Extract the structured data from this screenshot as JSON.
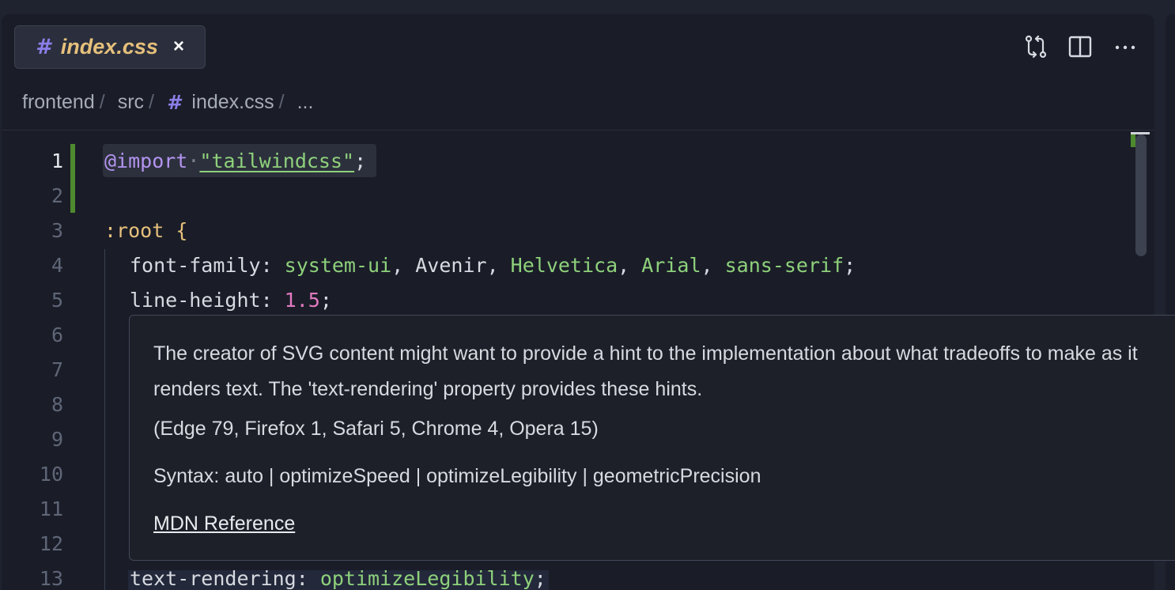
{
  "tab": {
    "icon": "hash-icon",
    "label": "index.css",
    "close": "×"
  },
  "toolbar": {
    "compare_icon": "git-compare-icon",
    "split_icon": "split-editor-icon",
    "more_icon": "ellipsis-icon",
    "more_label": "···"
  },
  "breadcrumb": {
    "items": [
      "frontend",
      "src",
      "index.css",
      "..."
    ],
    "separator": "/"
  },
  "editor": {
    "line_numbers": [
      "1",
      "2",
      "3",
      "4",
      "5",
      "6",
      "7",
      "8",
      "9",
      "10",
      "11",
      "12",
      "13"
    ],
    "active_line": "1",
    "line1": {
      "at": "@import",
      "dot": "·",
      "str": "\"tailwindcss\"",
      "semi": ";"
    },
    "line3": {
      "selector": ":root",
      "brace": "{"
    },
    "line4": {
      "prop": "font-family: ",
      "v1": "system-ui",
      "c1": ", ",
      "v2": "Avenir",
      "c2": ", ",
      "v3": "Helvetica",
      "c3": ", ",
      "v4": "Arial",
      "c4": ", ",
      "v5": "sans-serif",
      "semi": ";"
    },
    "line5": {
      "prop": "line-height: ",
      "num": "1.5",
      "semi": ";"
    },
    "line13": {
      "prop": "text-rendering: ",
      "val": "optimizeLegibility",
      "semi": ";"
    }
  },
  "hover": {
    "description": "The creator of SVG content might want to provide a hint to the implementation about what tradeoffs to make as it renders text. The 'text-rendering' property provides these hints.",
    "compat": "(Edge 79, Firefox 1, Safari 5, Chrome 4, Opera 15)",
    "syntax": "Syntax: auto | optimizeSpeed | optimizeLegibility | geometricPrecision",
    "link": "MDN Reference"
  },
  "colors": {
    "accent": "#8b7ee8",
    "tab_label": "#e6c07b",
    "git_added": "#4e8a2e",
    "string": "#8ed17b",
    "number": "#e07ac0",
    "keyword": "#b394f0"
  }
}
